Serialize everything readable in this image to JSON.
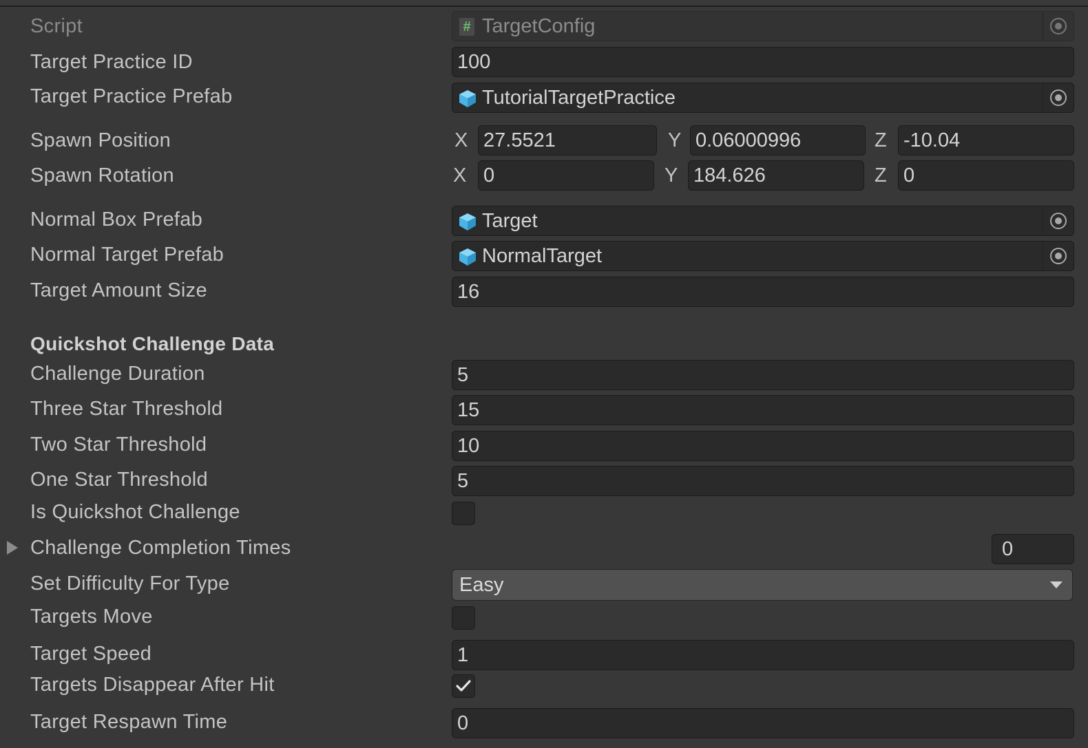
{
  "script": {
    "label": "Script",
    "value": "TargetConfig",
    "icon": "csharp-script-icon"
  },
  "fields": {
    "target_practice_id": {
      "label": "Target Practice ID",
      "value": "100"
    },
    "target_practice_prefab": {
      "label": "Target Practice Prefab",
      "value": "TutorialTargetPractice",
      "icon": "prefab-cube-icon"
    },
    "spawn_position": {
      "label": "Spawn Position",
      "x_label": "X",
      "x": "27.5521",
      "y_label": "Y",
      "y": "0.06000996",
      "z_label": "Z",
      "z": "-10.04"
    },
    "spawn_rotation": {
      "label": "Spawn Rotation",
      "x_label": "X",
      "x": "0",
      "y_label": "Y",
      "y": "184.626",
      "z_label": "Z",
      "z": "0"
    },
    "normal_box_prefab": {
      "label": "Normal Box Prefab",
      "value": "Target",
      "icon": "prefab-cube-icon"
    },
    "normal_target_prefab": {
      "label": "Normal Target Prefab",
      "value": "NormalTarget",
      "icon": "prefab-cube-icon"
    },
    "target_amount_size": {
      "label": "Target Amount Size",
      "value": "16"
    }
  },
  "quickshot": {
    "header": "Quickshot Challenge Data",
    "challenge_duration": {
      "label": "Challenge Duration",
      "value": "5"
    },
    "three_star_threshold": {
      "label": "Three Star Threshold",
      "value": "15"
    },
    "two_star_threshold": {
      "label": "Two Star Threshold",
      "value": "10"
    },
    "one_star_threshold": {
      "label": "One Star Threshold",
      "value": "5"
    },
    "is_quickshot_challenge": {
      "label": "Is Quickshot Challenge",
      "checked": false
    },
    "challenge_completion_times": {
      "label": "Challenge Completion Times",
      "size": "0",
      "expanded": false
    },
    "set_difficulty_for_type": {
      "label": "Set Difficulty For Type",
      "selected": "Easy"
    },
    "targets_move": {
      "label": "Targets Move",
      "checked": false
    },
    "target_speed": {
      "label": "Target Speed",
      "value": "1"
    },
    "targets_disappear_after_hit": {
      "label": "Targets Disappear After Hit",
      "checked": true
    },
    "target_respawn_time": {
      "label": "Target Respawn Time",
      "value": "0"
    }
  },
  "colors": {
    "background": "#383838",
    "field": "#2a2a2a",
    "dropdown": "#515151",
    "prefab_icon": "#5cc8f0"
  }
}
